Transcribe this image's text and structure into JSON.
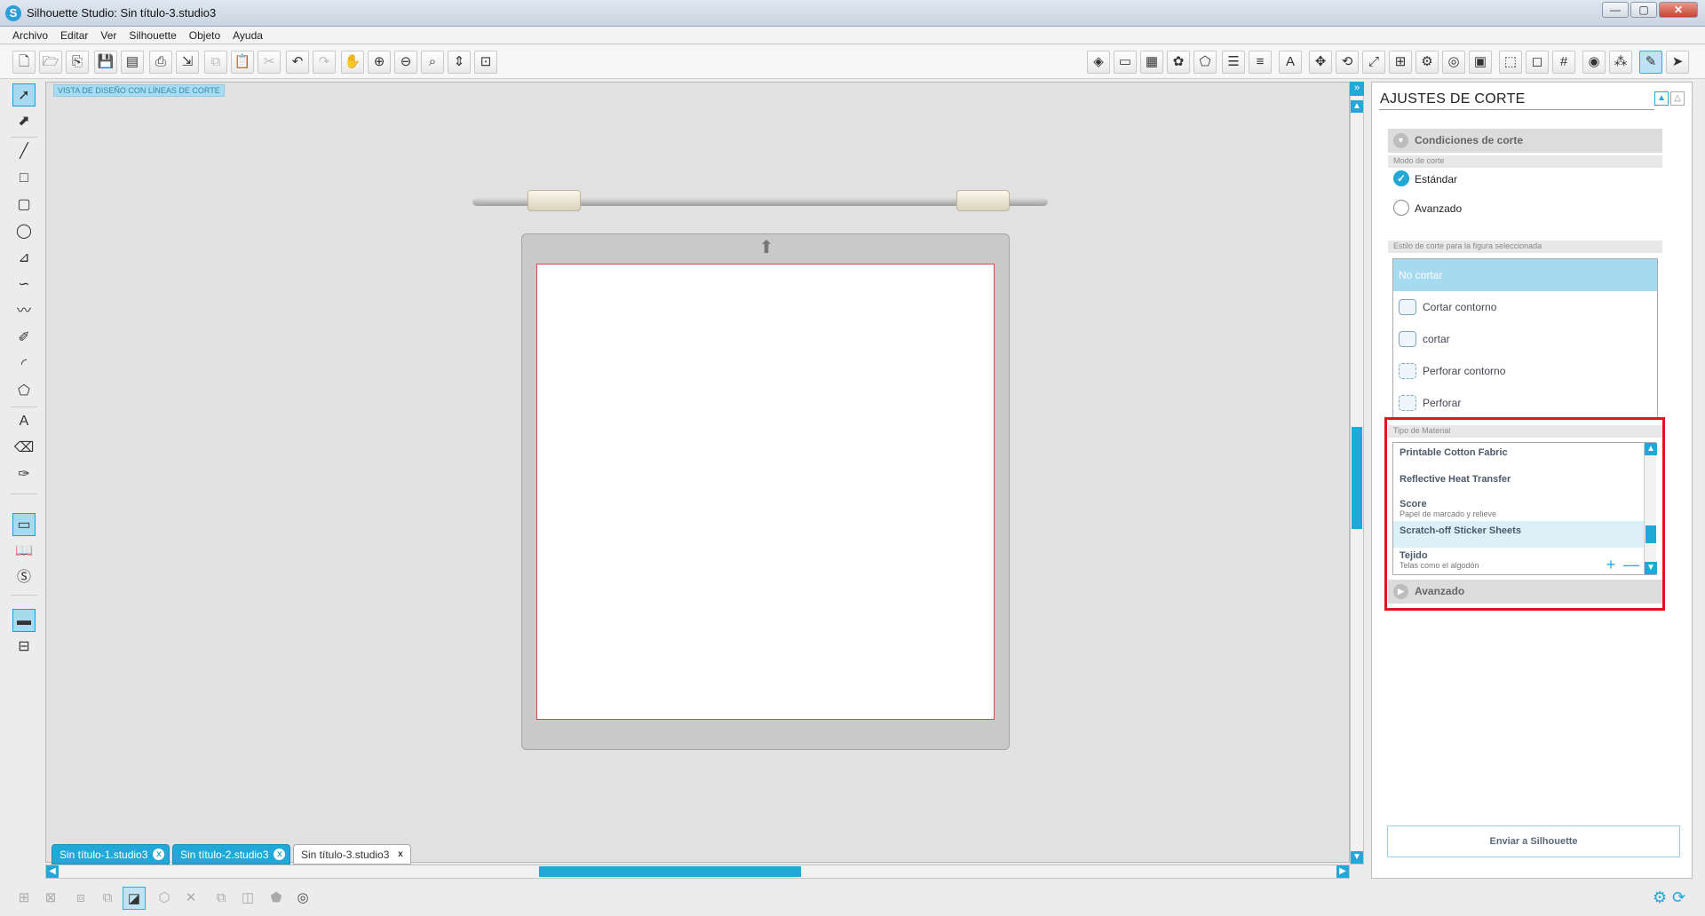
{
  "window": {
    "title": "Silhouette Studio: Sin título-3.studio3",
    "minimize": "—",
    "maximize": "▢",
    "close": "✕"
  },
  "menu": [
    "Archivo",
    "Editar",
    "Ver",
    "Silhouette",
    "Objeto",
    "Ayuda"
  ],
  "canvas": {
    "view_label": "VISTA DE DISEÑO CON LÍNEAS DE CORTE"
  },
  "doc_tabs": [
    {
      "label": "Sin título-1.studio3",
      "close": "x"
    },
    {
      "label": "Sin título-2.studio3",
      "close": "x"
    },
    {
      "label": "Sin título-3.studio3",
      "close": "x"
    }
  ],
  "panel": {
    "title": "AJUSTES DE CORTE",
    "conditions": {
      "header": "Condiciones de corte",
      "mode_label": "Modo de corte",
      "mode_options": [
        "Estándar",
        "Avanzado"
      ],
      "selected_mode": "Estándar",
      "style_label": "Estilo de corte para la figura seleccionada",
      "styles": [
        "No cortar",
        "Cortar contorno",
        "cortar",
        "Perforar contorno",
        "Perforar"
      ],
      "selected_style": "No cortar"
    },
    "material": {
      "label": "Tipo de Material",
      "items": [
        {
          "name": "Printable Cotton Fabric",
          "desc": ""
        },
        {
          "name": "Reflective Heat Transfer",
          "desc": ""
        },
        {
          "name": "Score",
          "desc": "Papel de marcado y relieve"
        },
        {
          "name": "Scratch-off Sticker Sheets",
          "desc": ""
        },
        {
          "name": "Tejido",
          "desc": "Telas como el algodón"
        }
      ],
      "highlighted": "Scratch-off Sticker Sheets",
      "add": "+",
      "remove": "—"
    },
    "advanced": {
      "header": "Avanzado"
    },
    "send_button": "Enviar a Silhouette"
  },
  "icons": {
    "toolbar": [
      "new-icon",
      "open-icon",
      "open-library-icon",
      "save-icon",
      "save-library-icon",
      "print-icon",
      "print-cut-icon",
      "copy-icon",
      "paste-icon",
      "cut-icon",
      "undo-icon",
      "redo-icon",
      "pan-icon",
      "zoom-in-icon",
      "zoom-out-icon",
      "zoom-select-icon",
      "zoom-drag-icon",
      "fit-page-icon"
    ],
    "colors": {
      "accent": "#22a7d9",
      "highlight": "#e0161c"
    }
  }
}
